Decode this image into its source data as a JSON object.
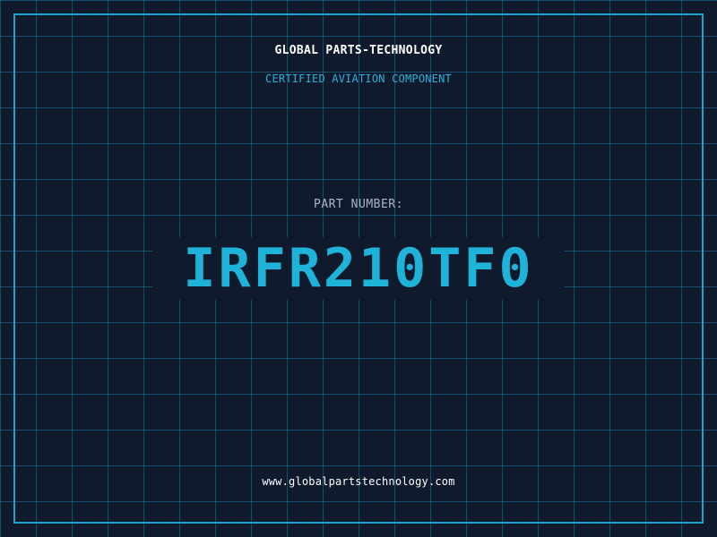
{
  "header": {
    "company": "GLOBAL PARTS-TECHNOLOGY",
    "subtitle": "CERTIFIED AVIATION COMPONENT"
  },
  "part": {
    "label": "PART NUMBER:",
    "number": "IRFR210TF0"
  },
  "footer": {
    "website": "www.globalpartstechnology.com"
  },
  "colors": {
    "background": "#0f1b2d",
    "grid": "#1e8cb4",
    "accent": "#1fb3da",
    "border": "#1aa3cc",
    "text": "#ffffff",
    "muted": "#a9b6c6"
  }
}
